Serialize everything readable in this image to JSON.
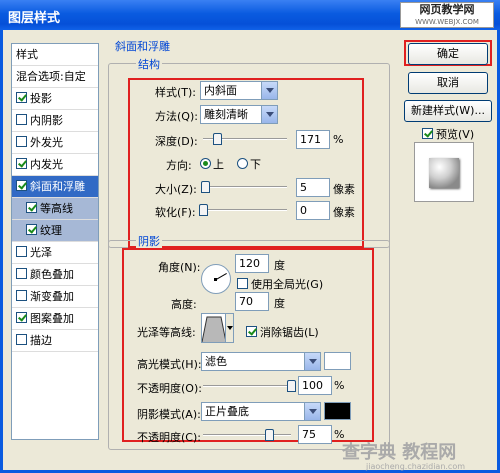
{
  "window": {
    "title": "图层样式"
  },
  "watermark_top": {
    "line1": "网页教学网",
    "line2": "WWW.WEBJX.COM"
  },
  "watermark_bottom": {
    "line1": "查字典 教程网",
    "line2": "jiaocheng.chazidian.com"
  },
  "style_list": {
    "header": "样式",
    "items": [
      {
        "label": "混合选项:自定"
      },
      {
        "label": "投影",
        "checked": true
      },
      {
        "label": "内阴影",
        "checked": false
      },
      {
        "label": "外发光",
        "checked": false
      },
      {
        "label": "内发光",
        "checked": true
      },
      {
        "label": "斜面和浮雕",
        "checked": true,
        "selected": true
      },
      {
        "label": "等高线",
        "checked": true,
        "sub": true
      },
      {
        "label": "纹理",
        "checked": true,
        "sub": true
      },
      {
        "label": "光泽",
        "checked": false
      },
      {
        "label": "颜色叠加",
        "checked": false
      },
      {
        "label": "渐变叠加",
        "checked": false
      },
      {
        "label": "图案叠加",
        "checked": true
      },
      {
        "label": "描边",
        "checked": false
      }
    ]
  },
  "bevel": {
    "section_title": "斜面和浮雕",
    "structure": {
      "legend": "结构",
      "style_label": "样式(T):",
      "style_value": "内斜面",
      "technique_label": "方法(Q):",
      "technique_value": "雕刻清晰",
      "depth_label": "深度(D):",
      "depth_value": "171",
      "depth_unit": "%",
      "depth_fraction": 0.17,
      "direction_label": "方向:",
      "direction_up": "上",
      "direction_down": "下",
      "direction_selected": "up",
      "size_label": "大小(Z):",
      "size_value": "5",
      "size_unit": "像素",
      "size_fraction": 0.02,
      "soften_label": "软化(F):",
      "soften_value": "0",
      "soften_unit": "像素",
      "soften_fraction": 0.0
    },
    "shading": {
      "legend": "阴影",
      "angle_label": "角度(N):",
      "angle_value": "120",
      "angle_unit": "度",
      "global_light_label": "使用全局光(G)",
      "global_light_checked": false,
      "altitude_label": "高度:",
      "altitude_value": "70",
      "altitude_unit": "度",
      "gloss_contour_label": "光泽等高线:",
      "antialiased_label": "消除锯齿(L)",
      "antialiased_checked": true,
      "highlight_mode_label": "高光模式(H):",
      "highlight_mode_value": "滤色",
      "highlight_color": "#ffffff",
      "highlight_opacity_label": "不透明度(O):",
      "highlight_opacity_value": "100",
      "highlight_opacity_unit": "%",
      "highlight_opacity_fraction": 1.0,
      "shadow_mode_label": "阴影模式(A):",
      "shadow_mode_value": "正片叠底",
      "shadow_color": "#000000",
      "shadow_opacity_label": "不透明度(C):",
      "shadow_opacity_value": "75",
      "shadow_opacity_unit": "%",
      "shadow_opacity_fraction": 0.75
    }
  },
  "buttons": {
    "ok": "确定",
    "cancel": "取消",
    "new_style": "新建样式(W)...",
    "preview_label": "预览(V)",
    "preview_checked": true
  },
  "colors": {
    "highlight_red": "#e02020",
    "accent_blue": "#0046d5"
  }
}
